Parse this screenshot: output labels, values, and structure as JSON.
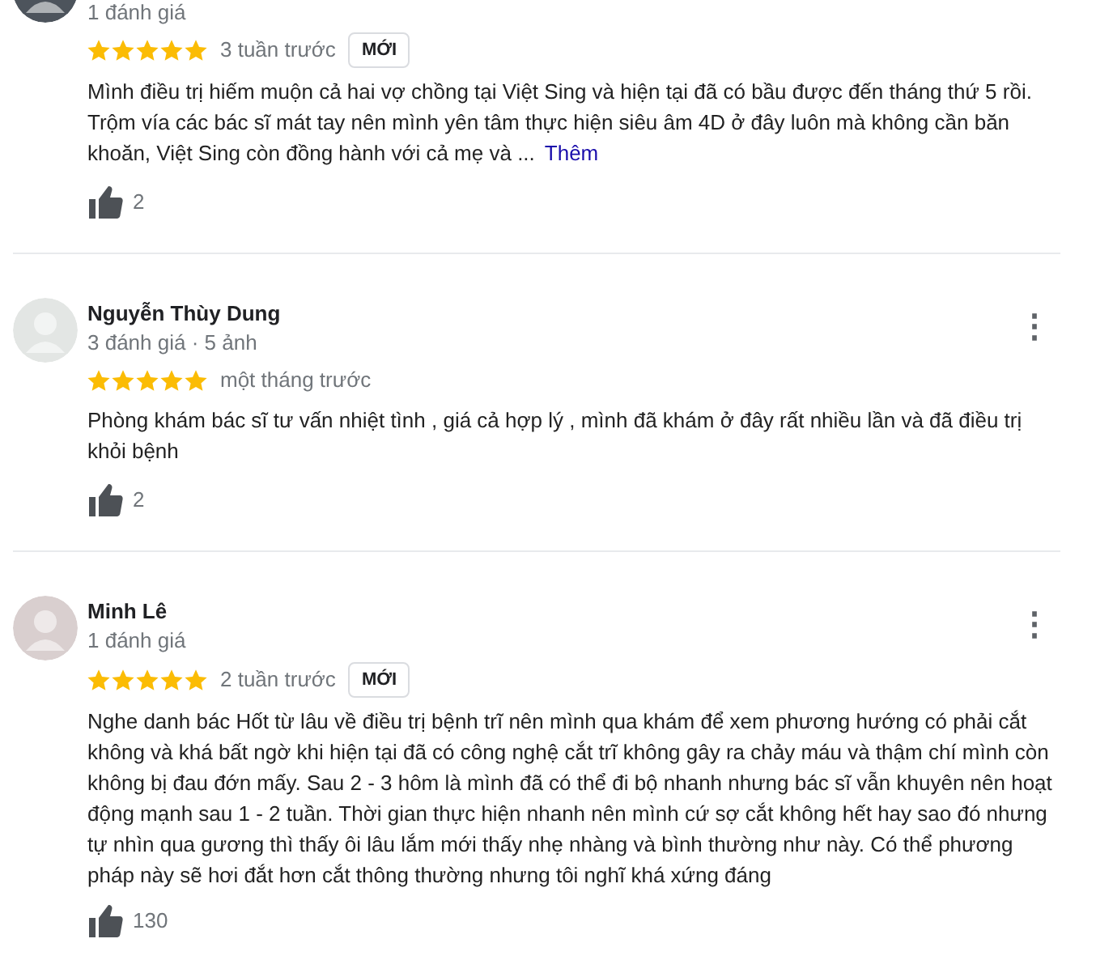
{
  "reviews": [
    {
      "avatar": {
        "color": "#4d545c"
      },
      "meta": "1 đánh giá",
      "stars": 5,
      "time": "3 tuần trước",
      "badge": "MỚI",
      "text": "Mình điều trị hiếm muộn cả hai vợ chồng tại Việt Sing và hiện tại đã có bầu được đến tháng thứ 5 rồi.\nTrộm vía các bác sĩ mát tay nên mình yên tâm thực hiện siêu âm 4D ở đây luôn mà không cần băn\nkhoăn, Việt Sing còn đồng hành với cả mẹ và ...",
      "more_link": "Thêm",
      "likes": "2"
    },
    {
      "avatar": {
        "color": "#e3e6e4"
      },
      "name": "Nguyễn Thùy Dung",
      "meta": "3 đánh giá · 5 ảnh",
      "menu": "⋮",
      "stars": 5,
      "time": "một tháng trước",
      "text": "Phòng khám bác sĩ tư vấn nhiệt tình , giá cả hợp lý , mình đã khám ở đây rất nhiều lần và đã điều trị\nkhỏi bệnh",
      "likes": "2"
    },
    {
      "avatar": {
        "color": "#d9cfcf"
      },
      "name": "Minh Lê",
      "meta": "1 đánh giá",
      "menu": "⋮",
      "stars": 5,
      "time": "2 tuần trước",
      "badge": "MỚI",
      "text": "Nghe danh bác Hốt từ lâu về điều trị bệnh trĩ nên mình qua khám để xem phương hướng có phải cắt\nkhông và khá bất ngờ khi hiện tại đã có công nghệ cắt trĩ không gây ra chảy máu và thậm chí mình còn\nkhông bị đau đớn mấy. Sau 2 - 3 hôm là mình đã có thể đi bộ nhanh nhưng bác sĩ vẫn khuyên nên hoạt\nđộng mạnh sau 1 - 2 tuần. Thời gian thực hiện nhanh nên mình cứ sợ cắt không hết hay sao đó nhưng\ntự nhìn qua gương thì thấy ôi lâu lắm mới thấy nhẹ nhàng và bình thường như này. Có thể phương\npháp này sẽ hơi đắt hơn cắt thông thường nhưng tôi nghĩ khá xứng đáng",
      "likes": "130"
    }
  ]
}
